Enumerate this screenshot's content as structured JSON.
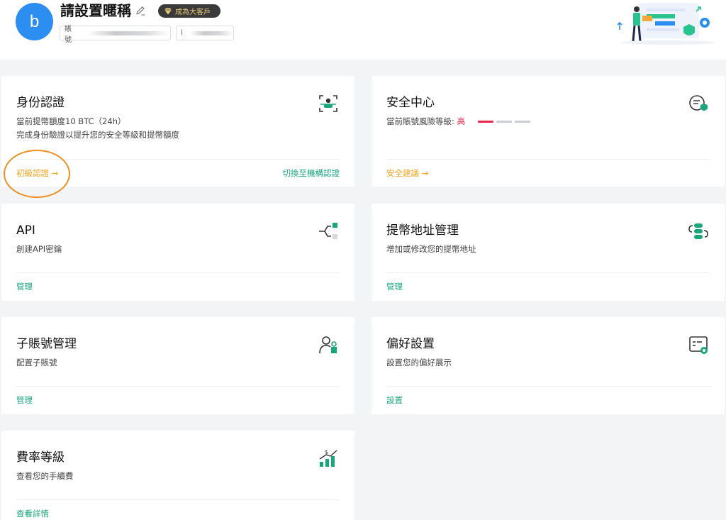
{
  "header": {
    "avatar_letter": "b",
    "nickname": "請設置暱稱",
    "vip_label": "成為大客戶",
    "account_label": "賬號",
    "uid_label": "l"
  },
  "cards": {
    "identity": {
      "title": "身份認證",
      "desc1": "當前提幣額度10 BTC（24h）",
      "desc2": "完成身份驗證以提升您的安全等級和提幣額度",
      "link": "初級認證 →",
      "link_right": "切換至機構認證"
    },
    "security": {
      "title": "安全中心",
      "desc_prefix": "當前賬號風險等級: ",
      "risk_level": "高",
      "risk_bars": [
        "#e6264f",
        "#c9cdd2",
        "#c9cdd2"
      ],
      "link": "安全建議 →"
    },
    "api": {
      "title": "API",
      "desc": "創建API密鑰",
      "link": "管理"
    },
    "withdraw": {
      "title": "提幣地址管理",
      "desc": "增加或修改您的提幣地址",
      "link": "管理"
    },
    "subaccount": {
      "title": "子賬號管理",
      "desc": "配置子賬號",
      "link": "管理"
    },
    "preferences": {
      "title": "偏好設置",
      "desc": "設置您的偏好展示",
      "link": "設置"
    },
    "fees": {
      "title": "費率等級",
      "desc": "查看您的手續費",
      "link": "查看詳情"
    }
  },
  "colors": {
    "accent_green": "#18a77a",
    "accent_orange": "#f4a11a",
    "risk_red": "#e6264f",
    "avatar_blue": "#2d8ef2"
  }
}
